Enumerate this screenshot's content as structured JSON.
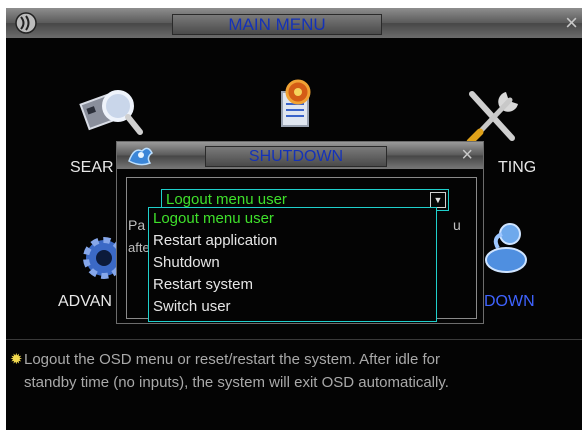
{
  "main_menu": {
    "title": "MAIN MENU",
    "close_glyph": "×",
    "items": [
      {
        "label": "SEAR",
        "icon": "search-icon"
      },
      {
        "label": "TING",
        "icon": "tools-icon"
      },
      {
        "label": "ADVAN",
        "icon": "gear-icon"
      },
      {
        "label": "DOWN",
        "icon": "user-icon"
      }
    ]
  },
  "shutdown_dialog": {
    "title": "SHUTDOWN",
    "close_glyph": "×",
    "body_text_left_1": "Pa",
    "body_text_left_2": "afte",
    "body_text_right_1": "u",
    "select": {
      "value": "Logout menu user",
      "options": [
        "Logout menu user",
        "Restart application",
        "Shutdown",
        "Restart system",
        "Switch user"
      ]
    }
  },
  "hint": {
    "line1": "Logout the OSD menu or reset/restart the system. After idle for",
    "line2": "standby time (no inputs), the system will exit OSD automatically."
  },
  "colors": {
    "accent_cyan": "#1fd0cc",
    "selected_green": "#3fe02b",
    "title_blue": "#1432b8",
    "label_blue": "#3f63ff"
  }
}
